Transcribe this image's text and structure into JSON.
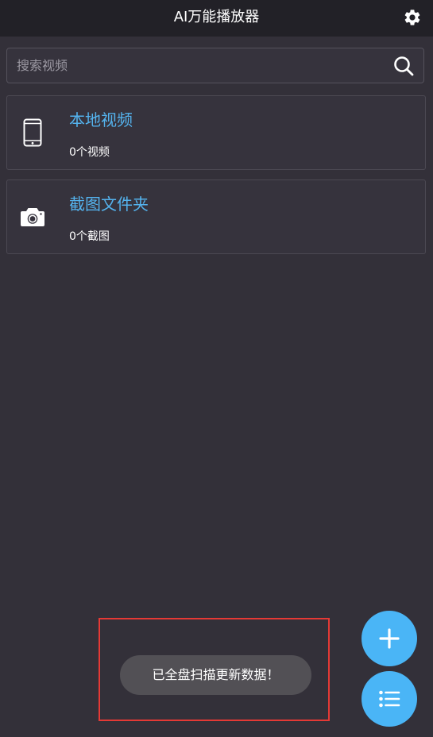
{
  "app": {
    "title": "AI万能播放器"
  },
  "icons": {
    "settings": "gear-icon",
    "search": "search-icon",
    "local_videos": "smartphone-icon",
    "screenshots": "camera-icon",
    "add": "plus-icon",
    "list": "list-icon"
  },
  "search": {
    "placeholder": "搜索视频",
    "value": ""
  },
  "folders": [
    {
      "title": "本地视频",
      "subtitle": "0个视频"
    },
    {
      "title": "截图文件夹",
      "subtitle": "0个截图"
    }
  ],
  "toast": {
    "message": "已全盘扫描更新数据！"
  },
  "colors": {
    "background": "#333039",
    "topbar": "#222127",
    "accent": "#4ab5f6",
    "folder_title": "#54b3ee",
    "highlight_frame": "#e53935"
  }
}
